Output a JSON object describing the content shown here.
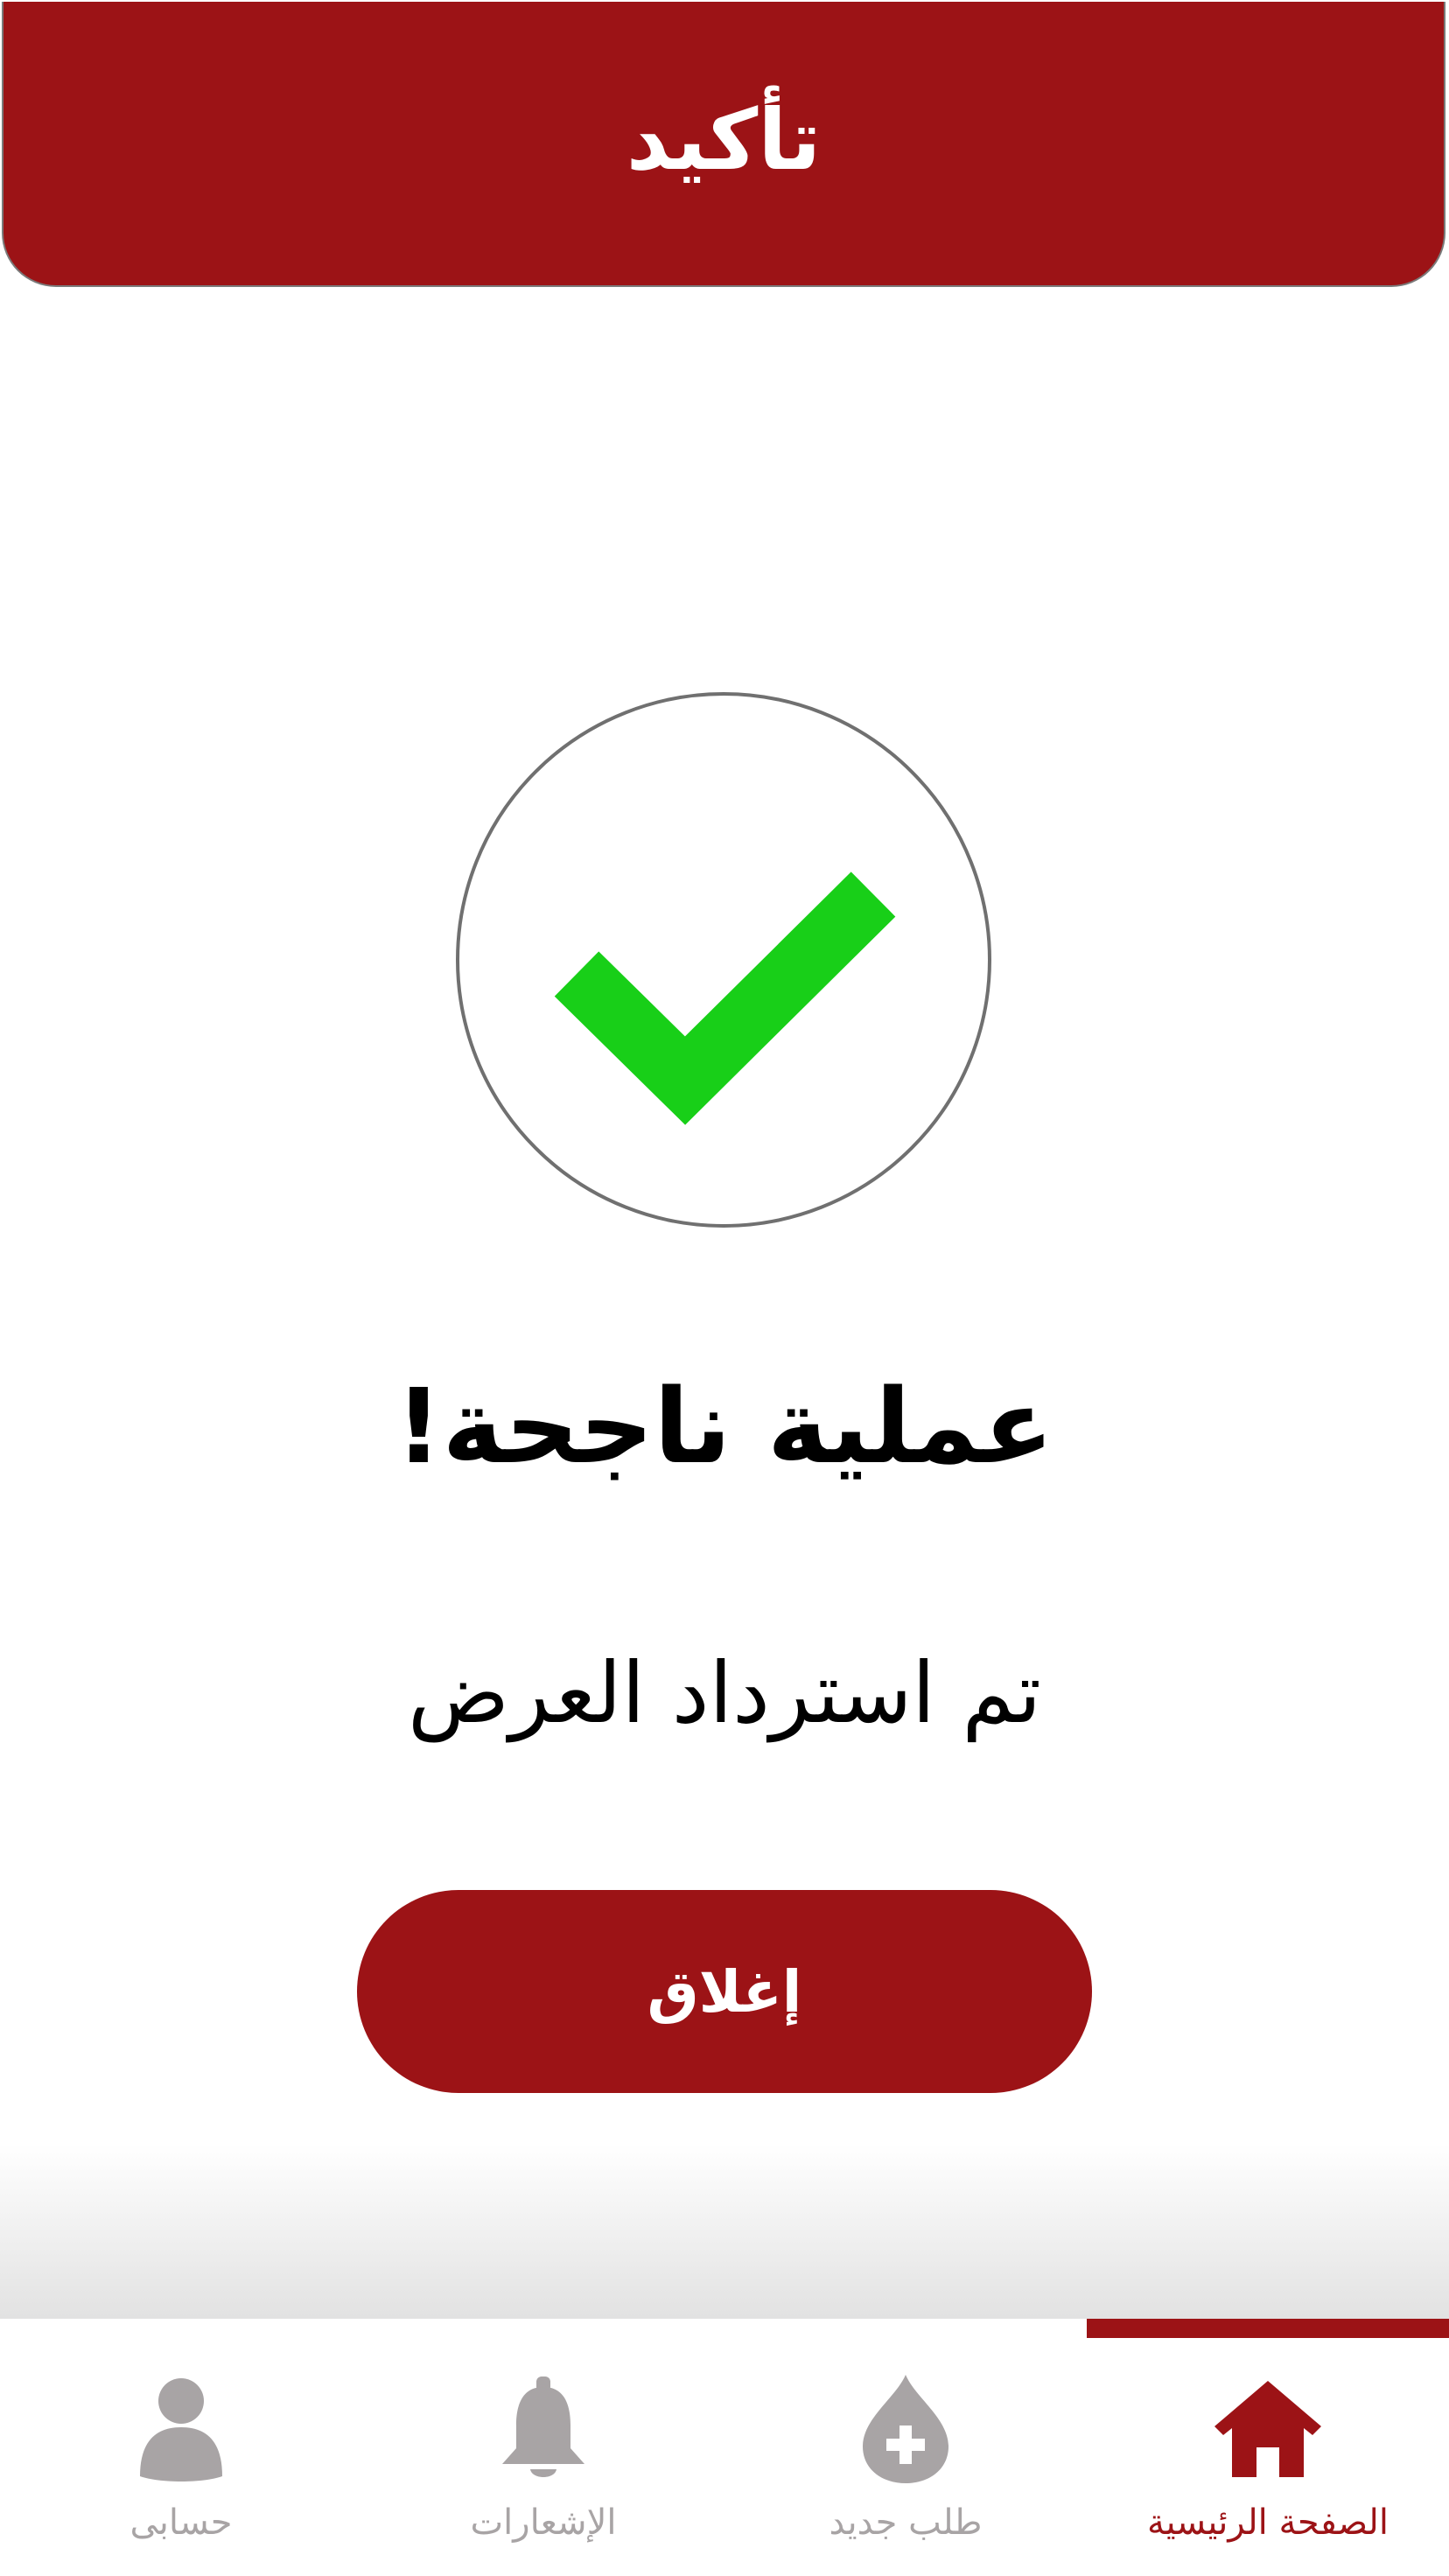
{
  "header": {
    "title": "تأكيد"
  },
  "status": {
    "icon": "checkmark-icon",
    "title": "عملية ناجحة!",
    "message": "تم استرداد العرض"
  },
  "actions": {
    "close_label": "إغلاق"
  },
  "tabbar": {
    "tabs": [
      {
        "label": "حسابى",
        "icon": "user-icon",
        "active": false
      },
      {
        "label": "الإشعارات",
        "icon": "bell-icon",
        "active": false
      },
      {
        "label": "طلب جديد",
        "icon": "blood-drop-plus-icon",
        "active": false
      },
      {
        "label": "الصفحة الرئيسية",
        "icon": "home-icon",
        "active": true
      }
    ]
  },
  "colors": {
    "primary": "#9c1316",
    "success": "#18cf18",
    "inactive": "#a8a4a5"
  }
}
